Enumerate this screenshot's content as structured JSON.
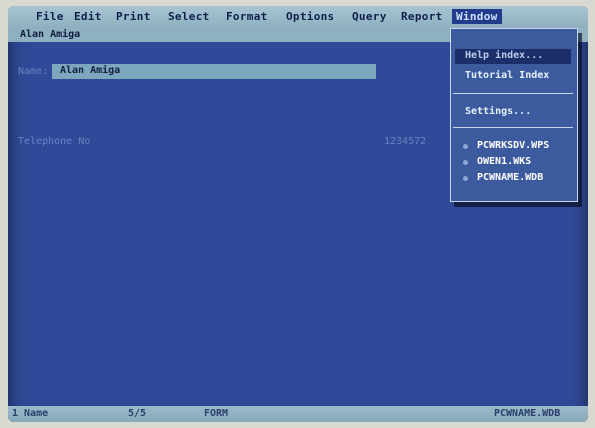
{
  "menubar": {
    "items": [
      "File",
      "Edit",
      "Print",
      "Select",
      "Format",
      "Options",
      "Query",
      "Report",
      "Window"
    ],
    "active": "Window"
  },
  "record": {
    "title": "Alan Amiga",
    "name_label": "Name:",
    "name_value": "Alan Amiga",
    "second_label": "Telephone No",
    "second_value": "1234572"
  },
  "window_menu": {
    "items": [
      "Help index...",
      "Tutorial Index",
      "Settings..."
    ],
    "highlighted": "Help index...",
    "open_files": [
      "PCWRKSDV.WPS",
      "OWEN1.WKS",
      "PCWNAME.WDB"
    ]
  },
  "status": {
    "record_indicator": "1 Name",
    "position": "5/5",
    "mode": "FORM",
    "file": "PCWNAME.WDB"
  },
  "colors": {
    "screen_bg": "#2f4a98",
    "menubar_bg": "#9cbbc9",
    "active_menu": "#233b8d",
    "field_bg": "#7da7bf"
  }
}
